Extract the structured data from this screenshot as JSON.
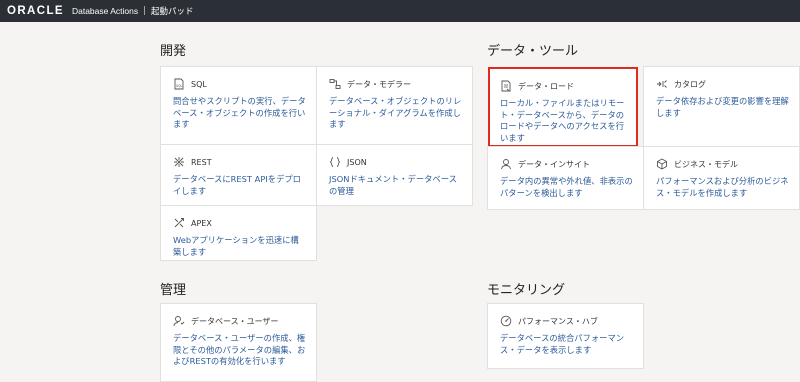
{
  "header": {
    "logo": "ORACLE",
    "app_name": "Database Actions",
    "separator": "|",
    "page_title": "起動パッド"
  },
  "sections": {
    "development": {
      "title": "開発",
      "cards": [
        {
          "title": "SQL",
          "icon": "sql-icon",
          "desc": "問合せやスクリプトの実行、データベース・オブジェクトの作成を行います"
        },
        {
          "title": "データ・モデラー",
          "icon": "data-modeler-icon",
          "desc": "データベース・オブジェクトのリレーショナル・ダイアグラムを作成します"
        },
        {
          "title": "REST",
          "icon": "rest-icon",
          "desc": "データベースにREST APIをデプロイします"
        },
        {
          "title": "JSON",
          "icon": "json-braces-icon",
          "desc": "JSONドキュメント・データベースの管理"
        },
        {
          "title": "APEX",
          "icon": "apex-icon",
          "desc": "Webアプリケーションを迅速に構築します"
        }
      ]
    },
    "data_tools": {
      "title": "データ・ツール",
      "cards": [
        {
          "title": "データ・ロード",
          "icon": "data-load-icon",
          "desc": "ローカル・ファイルまたはリモート・データベースから、データのロードやデータへのアクセスを行います"
        },
        {
          "title": "カタログ",
          "icon": "catalog-icon",
          "desc": "データ依存および変更の影響を理解します"
        },
        {
          "title": "データ・インサイト",
          "icon": "data-insights-icon",
          "desc": "データ内の異常や外れ値、非表示のパターンを検出します"
        },
        {
          "title": "ビジネス・モデル",
          "icon": "business-model-cube-icon",
          "desc": "パフォーマンスおよび分析のビジネス・モデルを作成します"
        }
      ]
    },
    "administration": {
      "title": "管理",
      "cards": [
        {
          "title": "データベース・ユーザー",
          "icon": "database-users-icon",
          "desc": "データベース・ユーザーの作成、権限とその他のパラメータの編集、およびRESTの有効化を行います"
        }
      ]
    },
    "monitoring": {
      "title": "モニタリング",
      "cards": [
        {
          "title": "パフォーマンス・ハブ",
          "icon": "performance-gauge-icon",
          "desc": "データベースの統合パフォーマンス・データを表示します"
        }
      ]
    }
  },
  "colors": {
    "topbar": "#2b2f36",
    "link_text": "#2d5c9a",
    "highlight": "#e02a1f"
  }
}
